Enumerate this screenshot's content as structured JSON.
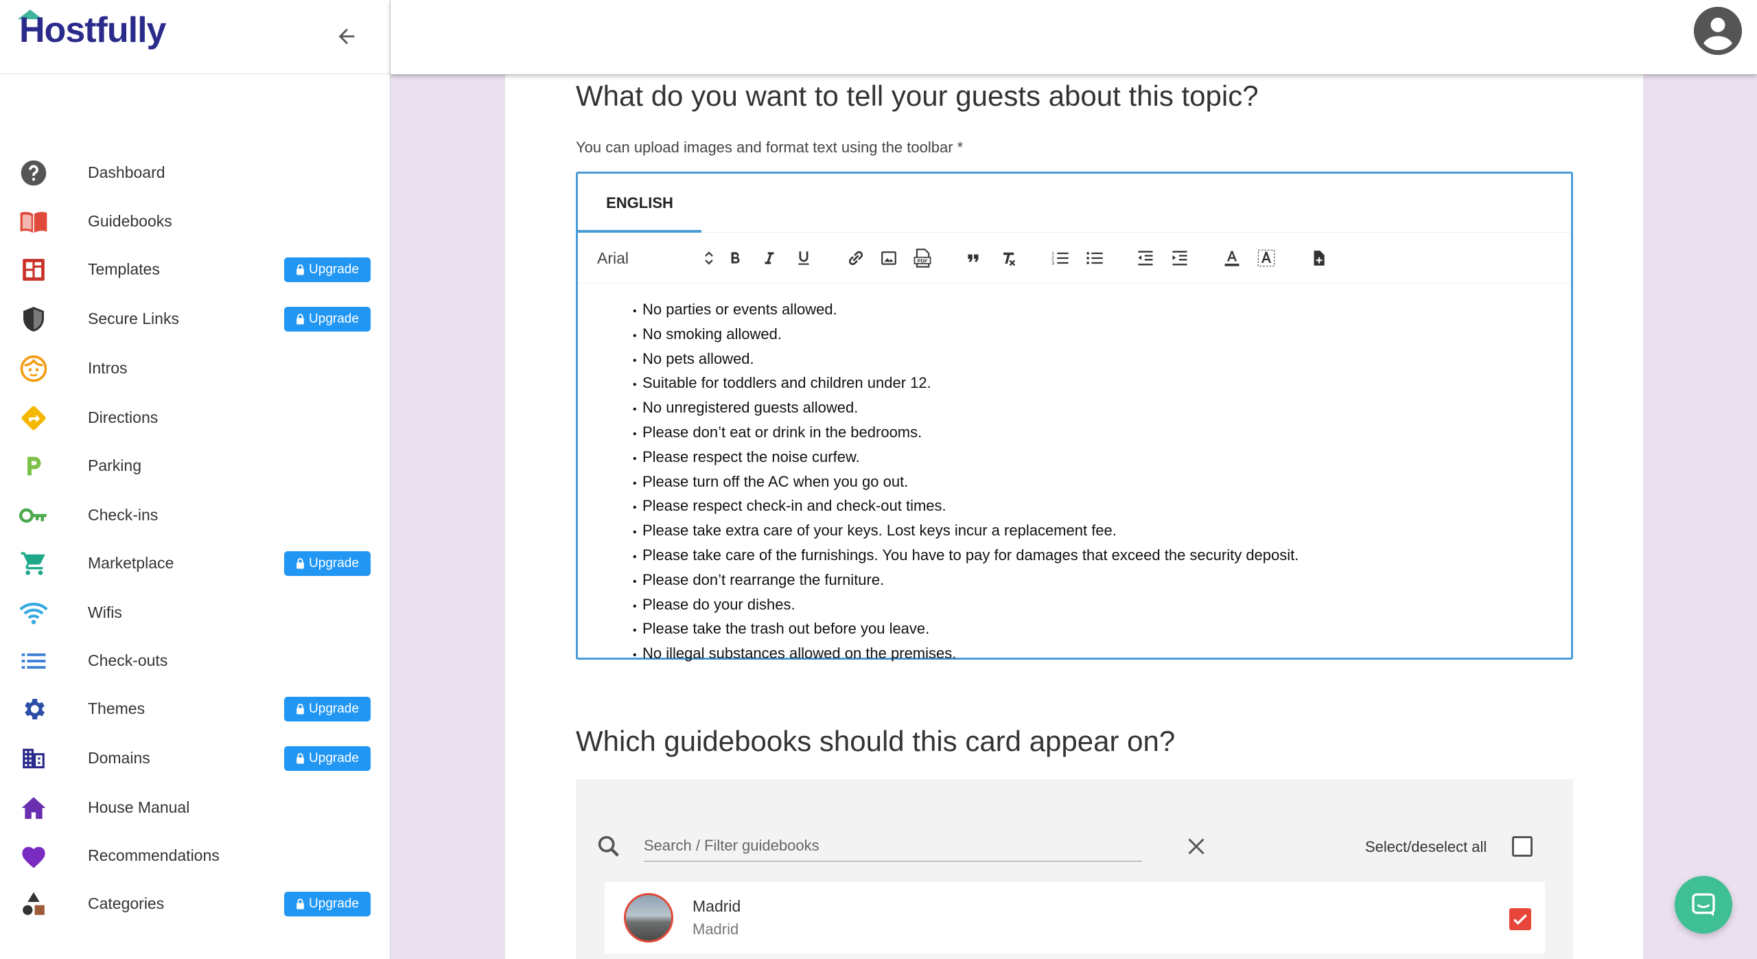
{
  "brand": {
    "name": "Hostfully"
  },
  "sidebar": {
    "upgrade_label": "Upgrade",
    "items": [
      {
        "label": "Dashboard",
        "icon": "help-circle-icon",
        "upgrade": false
      },
      {
        "label": "Guidebooks",
        "icon": "open-book-icon",
        "upgrade": false
      },
      {
        "label": "Templates",
        "icon": "template-grid-icon",
        "upgrade": true
      },
      {
        "label": "Secure Links",
        "icon": "shield-icon",
        "upgrade": true
      },
      {
        "label": "Intros",
        "icon": "face-icon",
        "upgrade": false
      },
      {
        "label": "Directions",
        "icon": "directions-sign-icon",
        "upgrade": false
      },
      {
        "label": "Parking",
        "icon": "parking-icon",
        "upgrade": false
      },
      {
        "label": "Check-ins",
        "icon": "key-icon",
        "upgrade": false
      },
      {
        "label": "Marketplace",
        "icon": "cart-icon",
        "upgrade": true
      },
      {
        "label": "Wifis",
        "icon": "wifi-icon",
        "upgrade": false
      },
      {
        "label": "Check-outs",
        "icon": "list-icon",
        "upgrade": false
      },
      {
        "label": "Themes",
        "icon": "gear-icon",
        "upgrade": true
      },
      {
        "label": "Domains",
        "icon": "building-icon",
        "upgrade": true
      },
      {
        "label": "House Manual",
        "icon": "home-icon",
        "upgrade": false
      },
      {
        "label": "Recommendations",
        "icon": "heart-icon",
        "upgrade": false
      },
      {
        "label": "Categories",
        "icon": "shapes-icon",
        "upgrade": true
      }
    ]
  },
  "main": {
    "topic_heading": "What do you want to tell your guests about this topic?",
    "topic_helper": "You can upload images and format text using the toolbar *",
    "editor": {
      "tabs": [
        "ENGLISH"
      ],
      "active_tab": "ENGLISH",
      "font": "Arial",
      "toolbar": [
        "bold-icon",
        "italic-icon",
        "underline-icon",
        "link-icon",
        "image-icon",
        "pdf-icon",
        "quote-icon",
        "clear-format-icon",
        "ordered-list-icon",
        "bullet-list-icon",
        "outdent-icon",
        "indent-icon",
        "text-color-icon",
        "highlight-icon",
        "insert-file-icon"
      ],
      "rules": [
        "No parties or events allowed.",
        "No smoking allowed.",
        "No pets allowed.",
        "Suitable for toddlers and children under 12.",
        "No unregistered guests allowed.",
        "Please don’t eat or drink in the bedrooms.",
        "Please respect the noise curfew.",
        "Please turn off the AC when you go out.",
        "Please respect check-in and check-out times.",
        "Please take extra care of your keys. Lost keys incur a replacement fee.",
        "Please take care of the furnishings. You have to pay for damages that exceed the security deposit.",
        "Please don’t rearrange the furniture.",
        "Please do your dishes.",
        "Please take the trash out before you leave.",
        "No illegal substances allowed on the premises."
      ]
    },
    "guidebooks_heading": "Which guidebooks should this card appear on?",
    "guidebooks": {
      "search_placeholder": "Search / Filter guidebooks",
      "search_value": "",
      "select_all_label": "Select/deselect all",
      "select_all_checked": false,
      "items": [
        {
          "name": "Madrid",
          "subtitle": "Madrid",
          "checked": true
        }
      ]
    }
  },
  "colors": {
    "brand_navy": "#2b2b8c",
    "brand_teal": "#3fb39b",
    "upgrade_blue": "#2196f3",
    "editor_border": "#4a9bd6",
    "checkbox_red": "#e8463a",
    "chat_green": "#3fbf94",
    "page_bg": "#ebe0ef"
  }
}
